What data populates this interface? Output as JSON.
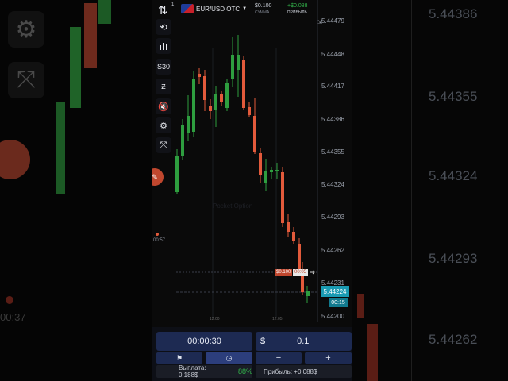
{
  "header": {
    "asset": "EUR/USD OTC",
    "amount_value": "$0.100",
    "amount_label": "СУММА",
    "profit_value": "+$0.088",
    "profit_label": "ПРИБЫЛЬ",
    "badge": "1"
  },
  "toolbar": {
    "timeframe": "S30",
    "draw_icon": "ƶ"
  },
  "chart": {
    "price_labels": [
      "5.44479",
      "5.44448",
      "5.44417",
      "5.44386",
      "5.44355",
      "5.44324",
      "5.44293",
      "5.44262",
      "5.44231",
      "5.44200"
    ],
    "current_price": "5.44224",
    "countdown": "00:15",
    "trade_amount": "$0.100",
    "trade_timer": "00:05",
    "time_labels": [
      "12:00",
      "12:05"
    ],
    "left_side_time": "00:57"
  },
  "order": {
    "duration": "00:00:30",
    "currency_symbol": "$",
    "amount": "0.1",
    "minus": "−",
    "plus": "+",
    "payout_label": "Выплата: 0.188$",
    "percent": "88%",
    "profit_label": "Прибыль: +0.088$"
  },
  "background": {
    "right_prices": [
      "5.44386",
      "5.44355",
      "5.44324",
      "5.44293",
      "5.44262"
    ],
    "left_time": "00:37"
  },
  "colors": {
    "up": "#2e9e3f",
    "down": "#e25a3b",
    "accent": "#1a9bb3",
    "panel": "#1d2a52"
  }
}
